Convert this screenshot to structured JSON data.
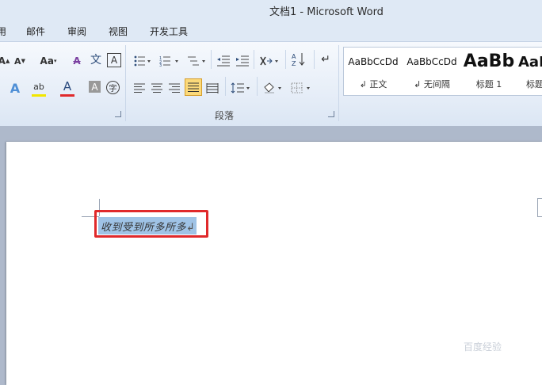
{
  "window": {
    "title": "文档1  -  Microsoft Word"
  },
  "tabs": [
    {
      "label": "用"
    },
    {
      "label": "邮件"
    },
    {
      "label": "审阅"
    },
    {
      "label": "视图"
    },
    {
      "label": "开发工具"
    }
  ],
  "ribbon": {
    "font_group": {
      "grow_font": "A",
      "shrink_font": "A",
      "change_case": "Aa",
      "clear_format": "A",
      "phonetic": "文",
      "char_border": "A",
      "text_effect": "A",
      "highlight": "ab",
      "font_color": "A",
      "char_shading": "A",
      "enclose_char": "字"
    },
    "paragraph_group": {
      "label": "段落"
    },
    "styles": [
      {
        "sample": "AaBbCcDd",
        "name": "↲ 正文"
      },
      {
        "sample": "AaBbCcDd",
        "name": "↲ 无间隔"
      },
      {
        "sample": "AaBb",
        "name": "标题 1"
      },
      {
        "sample": "AaB",
        "name": "标题"
      }
    ]
  },
  "document": {
    "text": "收到受到所多所多",
    "paragraph_mark": "↲"
  },
  "watermark": {
    "text": "百度经验"
  },
  "colors": {
    "selection": "#9fc3e6",
    "highlight_box": "#e0292b",
    "font_color_bar": "#e0292b",
    "highlight_bar": "#f2e600"
  }
}
